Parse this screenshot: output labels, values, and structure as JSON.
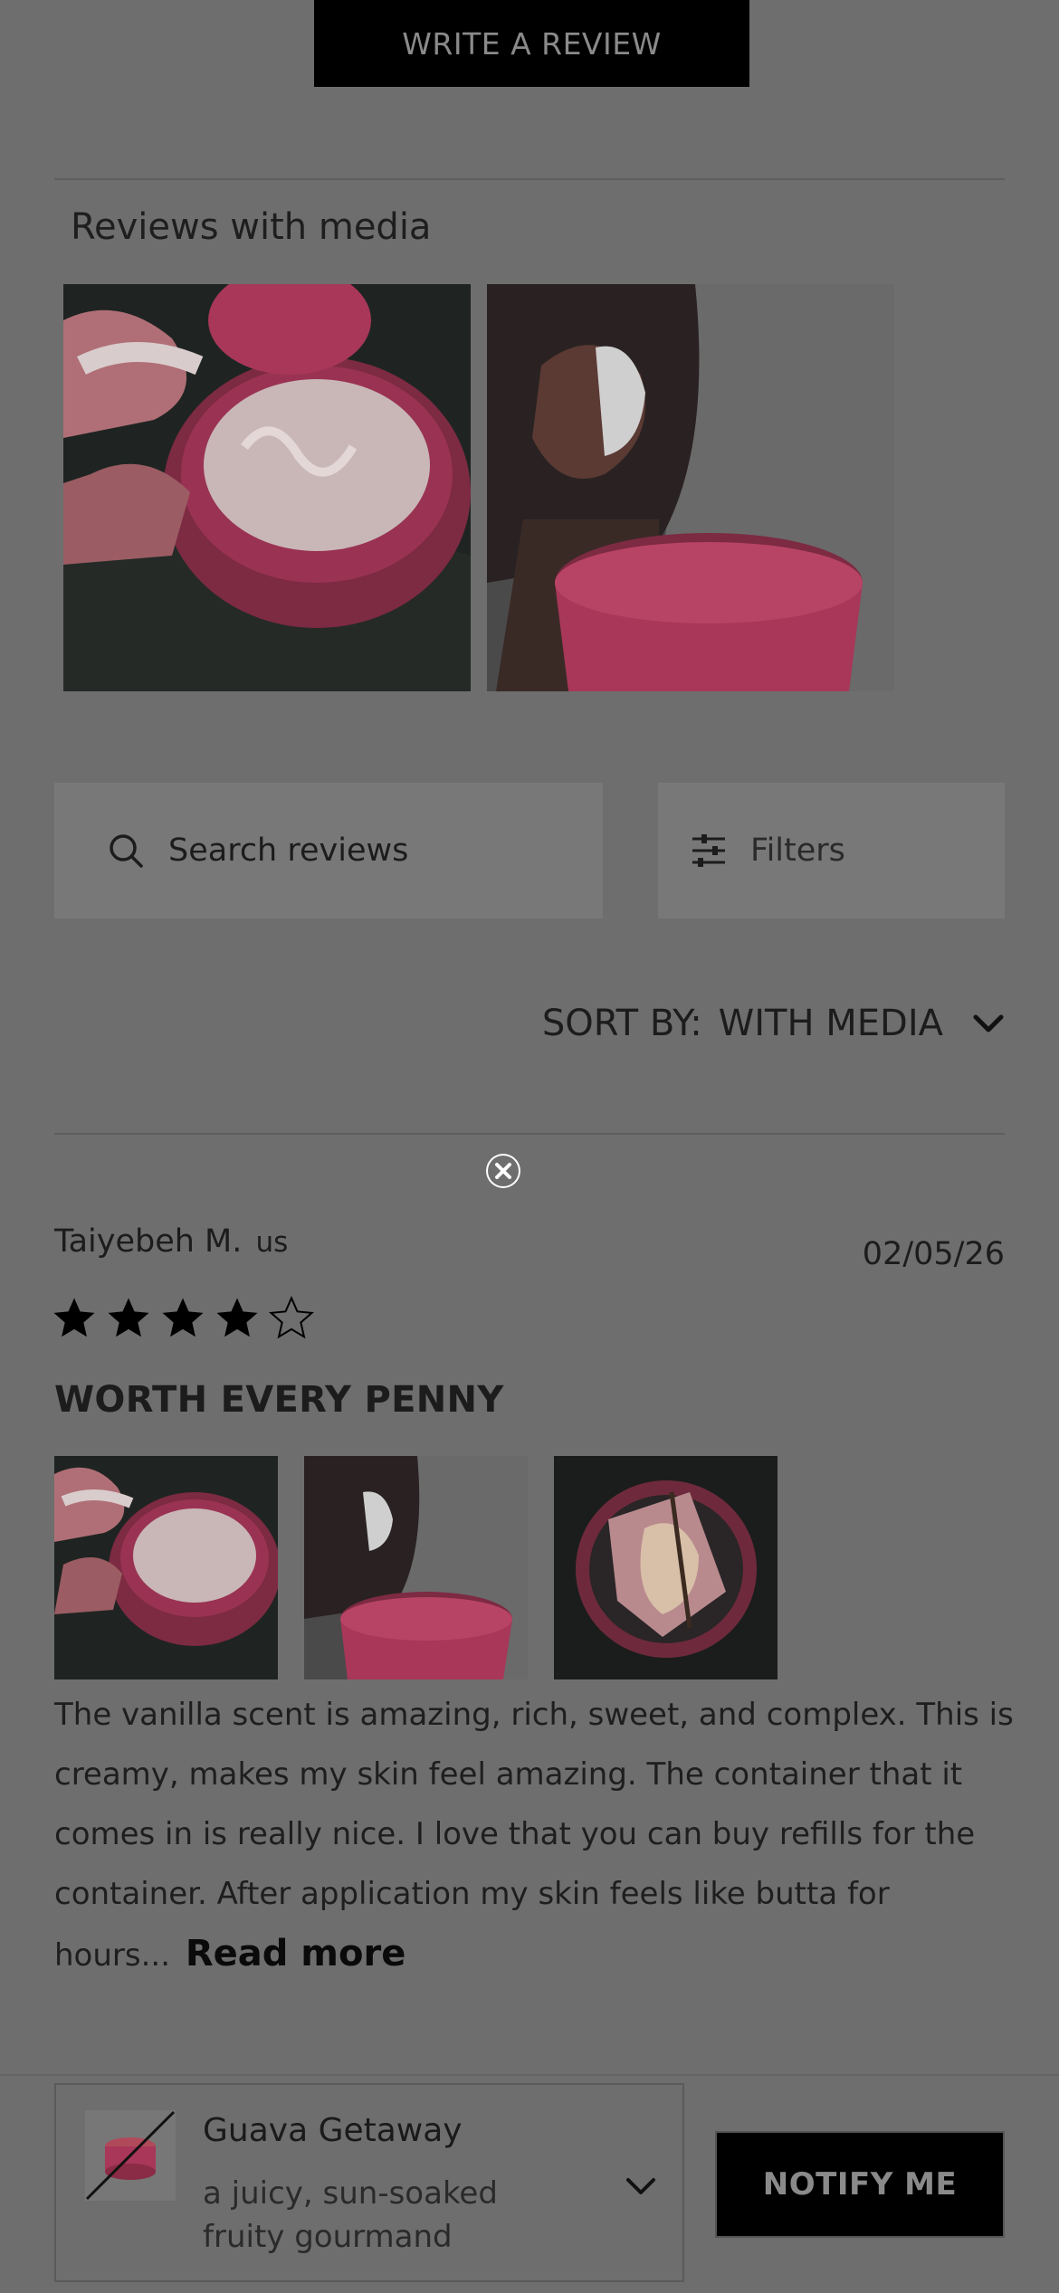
{
  "write_review": {
    "label": "WRITE A REVIEW"
  },
  "media_section": {
    "title": "Reviews with media"
  },
  "search": {
    "placeholder": "Search reviews"
  },
  "filters": {
    "label": "Filters"
  },
  "sort": {
    "label": "SORT BY:",
    "value": "WITH MEDIA"
  },
  "review": {
    "author": "Taiyebeh M.",
    "country": "us",
    "date": "02/05/26",
    "rating": 4,
    "rating_max": 5,
    "title": "WORTH EVERY PENNY",
    "body": "The vanilla scent is amazing, rich, sweet, and complex. This is creamy, makes my skin feel amazing. The container that it comes in is really nice. I love that you can buy refills for the container. After application my skin feels like butta for hours...",
    "read_more": "Read more"
  },
  "product": {
    "name": "Guava Getaway",
    "description": "a juicy, sun-soaked fruity gourmand"
  },
  "notify": {
    "label": "NOTIFY ME"
  },
  "icons": [
    "search-icon",
    "filters-icon",
    "chevron-down-icon",
    "close-icon",
    "star-icon",
    "chevron-down-icon"
  ],
  "colors": {
    "overlay": "#6e6e6e",
    "button": "#000000",
    "jar_pink": "#a8375a"
  }
}
